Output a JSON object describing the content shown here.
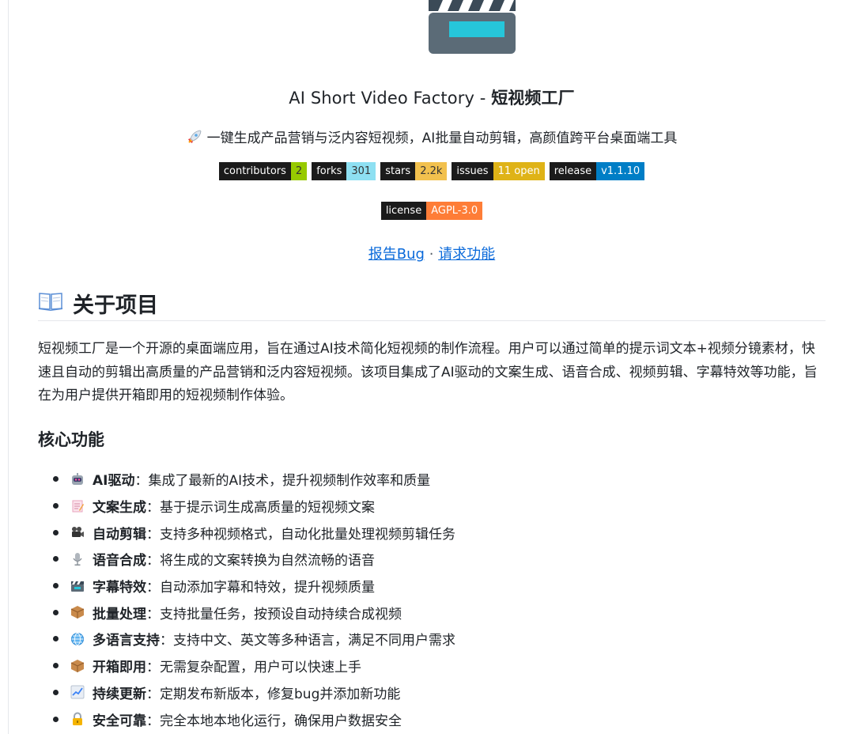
{
  "header": {
    "title_prefix": "AI Short Video Factory - ",
    "title_strong": "短视频工厂",
    "tagline": "一键生成产品营销与泛内容短视频，AI批量自动剪辑，高颜值跨平台桌面端工具"
  },
  "badges": [
    {
      "key": "contributors",
      "value": "2",
      "color": "#97ca00"
    },
    {
      "key": "forks",
      "value": "301",
      "color": "#8ee0f2"
    },
    {
      "key": "stars",
      "value": "2.2k",
      "color": "#f2c14e"
    },
    {
      "key": "issues",
      "value": "11 open",
      "color": "#dfb317"
    },
    {
      "key": "release",
      "value": "v1.1.10",
      "color": "#007ec6"
    },
    {
      "key": "license",
      "value": "AGPL-3.0",
      "color": "#fe7d37"
    }
  ],
  "links": {
    "report_bug": "报告Bug",
    "separator": "·",
    "request_feature": "请求功能"
  },
  "about": {
    "heading": "关于项目",
    "paragraph": "短视频工厂是一个开源的桌面端应用，旨在通过AI技术简化短视频的制作流程。用户可以通过简单的提示词文本+视频分镜素材，快速且自动的剪辑出高质量的产品营销和泛内容短视频。该项目集成了AI驱动的文案生成、语音合成、视频剪辑、字幕特效等功能，旨在为用户提供开箱即用的短视频制作体验。"
  },
  "features": {
    "heading": "核心功能",
    "items": [
      {
        "icon": "robot-icon",
        "name": "AI驱动",
        "desc": "：集成了最新的AI技术，提升视频制作效率和质量"
      },
      {
        "icon": "memo-icon",
        "name": "文案生成",
        "desc": "：基于提示词生成高质量的短视频文案"
      },
      {
        "icon": "camera-icon",
        "name": "自动剪辑",
        "desc": "：支持多种视频格式，自动化批量处理视频剪辑任务"
      },
      {
        "icon": "microphone-icon",
        "name": "语音合成",
        "desc": "：将生成的文案转换为自然流畅的语音"
      },
      {
        "icon": "clapper-icon",
        "name": "字幕特效",
        "desc": "：自动添加字幕和特效，提升视频质量"
      },
      {
        "icon": "package-icon",
        "name": "批量处理",
        "desc": "：支持批量任务，按预设自动持续合成视频"
      },
      {
        "icon": "globe-icon",
        "name": "多语言支持",
        "desc": "：支持中文、英文等多种语言，满足不同用户需求"
      },
      {
        "icon": "package-icon",
        "name": "开箱即用",
        "desc": "：无需复杂配置，用户可以快速上手"
      },
      {
        "icon": "chart-icon",
        "name": "持续更新",
        "desc": "：定期发布新版本，修复bug并添加新功能"
      },
      {
        "icon": "lock-icon",
        "name": "安全可靠",
        "desc": "：完全本地本地化运行，确保用户数据安全"
      }
    ]
  }
}
